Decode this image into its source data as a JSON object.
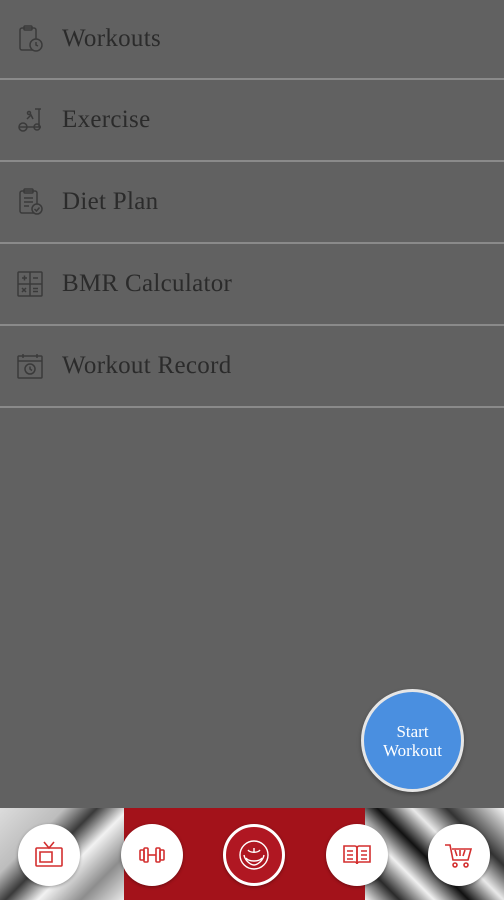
{
  "menu": {
    "items": [
      {
        "label": "Workouts",
        "icon": "clipboard-timer-icon"
      },
      {
        "label": "Exercise",
        "icon": "treadmill-icon"
      },
      {
        "label": "Diet Plan",
        "icon": "diet-checklist-icon"
      },
      {
        "label": "BMR Calculator",
        "icon": "calculator-icon"
      },
      {
        "label": "Workout Record",
        "icon": "calendar-clock-icon"
      }
    ]
  },
  "fab": {
    "line1": "Start",
    "line2": "Workout"
  },
  "bottom_nav": {
    "items": [
      {
        "icon": "tv-icon"
      },
      {
        "icon": "dumbbell-icon"
      },
      {
        "icon": "emblem-icon"
      },
      {
        "icon": "book-icon"
      },
      {
        "icon": "cart-icon"
      }
    ]
  },
  "colors": {
    "background": "#616161",
    "divider": "#8a8a8a",
    "menu_text": "#2b2b2b",
    "fab": "#4a8fe0",
    "accent_red": "#d32f2f",
    "banner_red": "#a3121a"
  }
}
